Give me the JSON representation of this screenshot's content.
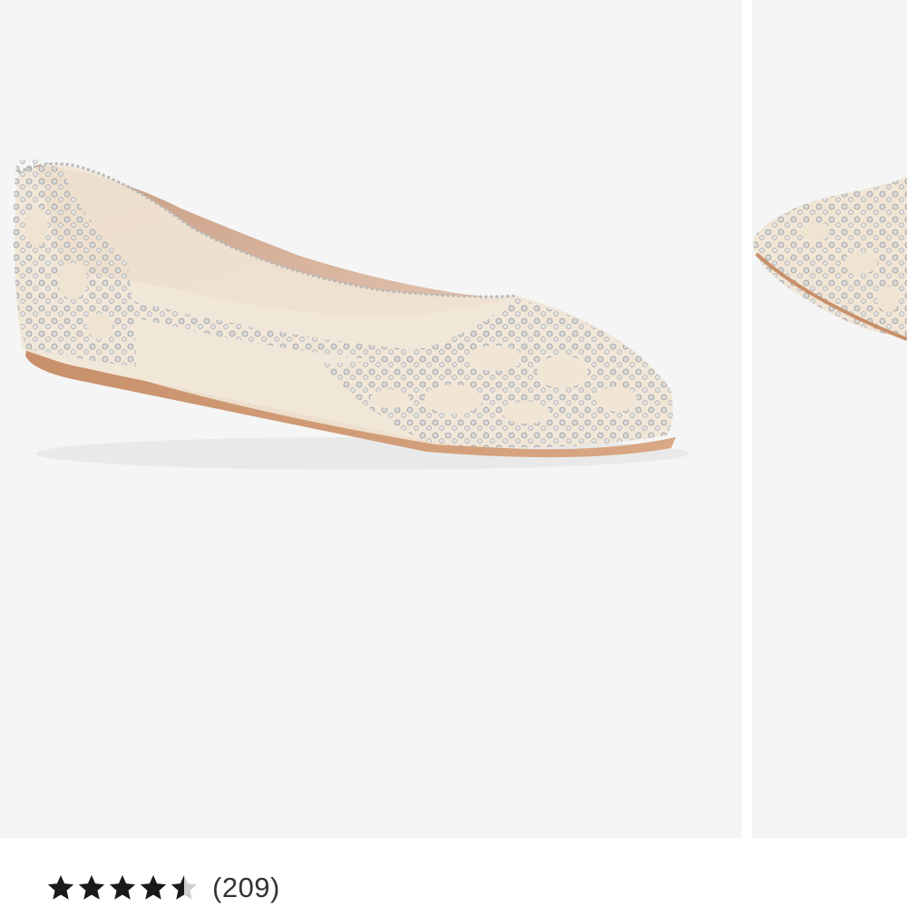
{
  "product": {
    "rating": {
      "value": 4.5,
      "max": 5,
      "review_count_label": "(209)"
    }
  },
  "colors": {
    "image_background": "#f5f5f5",
    "star_filled": "#1a1a1a",
    "star_empty": "#cfcfcf"
  },
  "icons": {
    "star_full": "star-icon",
    "star_half": "star-half-icon"
  }
}
